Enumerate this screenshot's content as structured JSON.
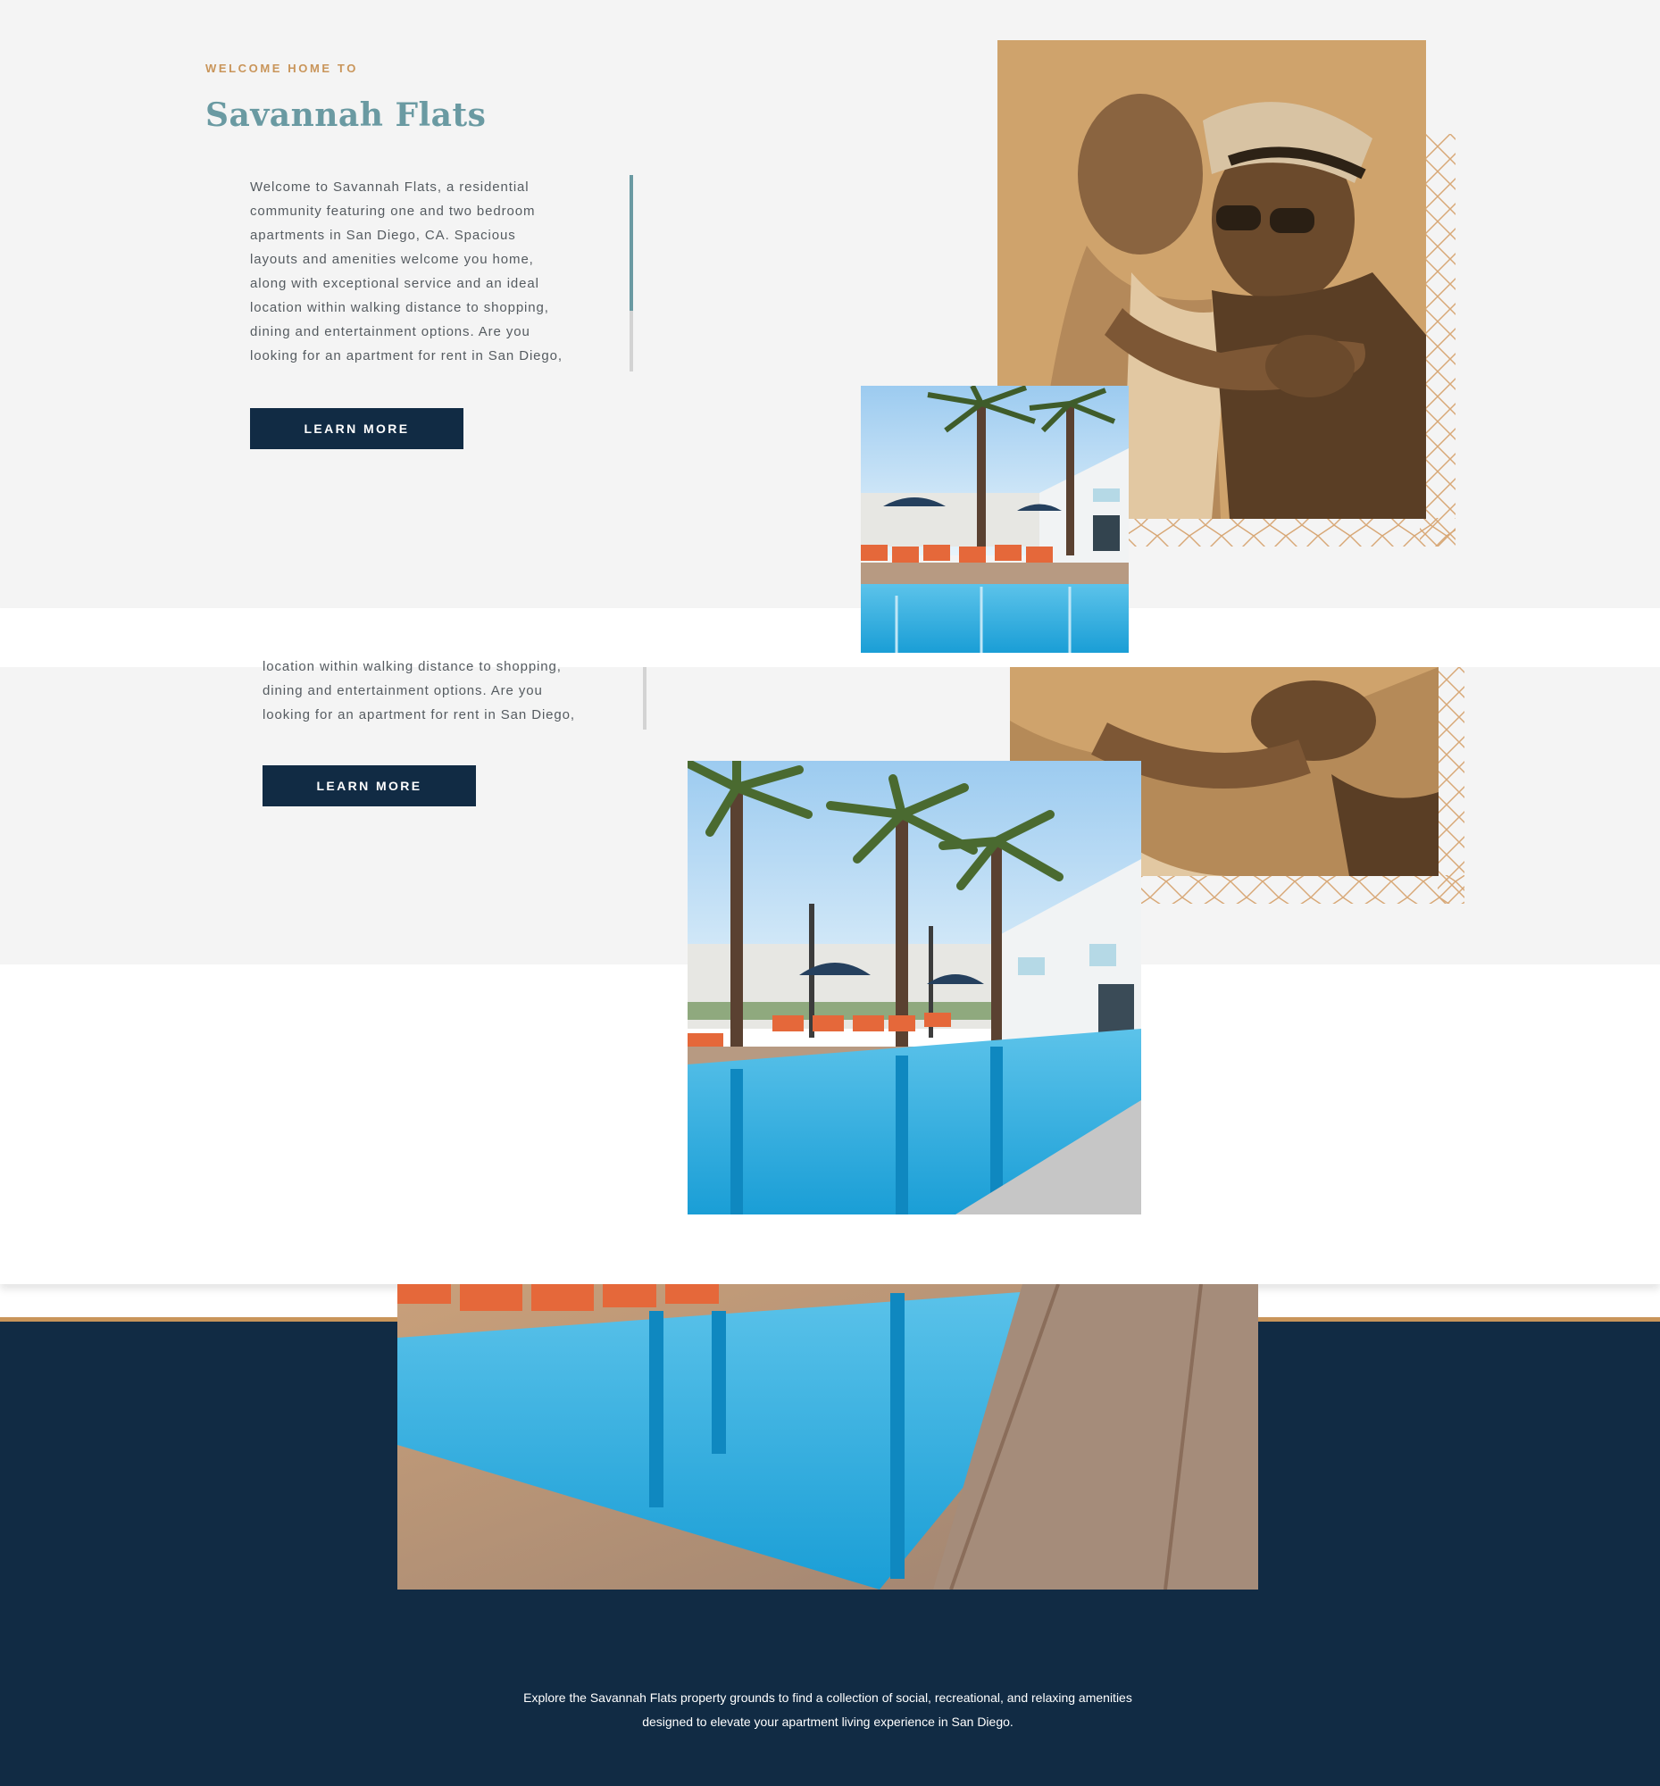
{
  "hero": {
    "eyebrow": "WELCOME HOME TO",
    "title": "Savannah Flats",
    "body": "Welcome to Savannah Flats, a residential\ncommunity featuring one and two bedroom\napartments in San Diego, CA. Spacious\nlayouts and amenities welcome you home,\nalong with exceptional service and an ideal\nlocation within walking distance to shopping,\ndining and entertainment options. Are you\nlooking for an apartment for rent in San Diego,",
    "cta_label": "LEARN MORE"
  },
  "hero_repeat": {
    "body": "location within walking distance to shopping,\ndining and entertainment options. Are you\nlooking for an apartment for rent in San Diego,",
    "cta_label": "LEARN MORE"
  },
  "amenities": {
    "caption": "Explore the Savannah Flats property grounds to find a collection of social, recreational, and relaxing amenities\ndesigned to elevate your apartment living experience in San Diego."
  },
  "colors": {
    "navy": "#112b44",
    "gold": "#c9955a",
    "teal": "#6a9aa2",
    "light_gray_bg": "#f4f4f4"
  },
  "icons": [
    "couple-photo",
    "pool-photo",
    "diamond-pattern"
  ]
}
